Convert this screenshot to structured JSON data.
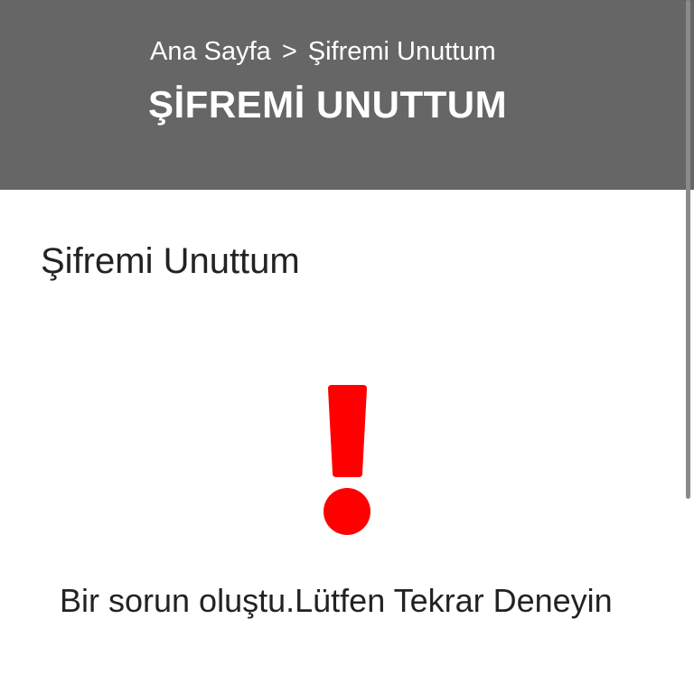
{
  "breadcrumb": {
    "home": "Ana Sayfa",
    "separator": ">",
    "current": "Şifremi Unuttum"
  },
  "header": {
    "title": "ŞİFREMİ UNUTTUM"
  },
  "main": {
    "section_title": "Şifremi Unuttum",
    "alert_icon": "exclamation-icon",
    "alert_color": "#ff0000",
    "error_message": "Bir sorun oluştu.Lütfen Tekrar Deneyin"
  },
  "colors": {
    "header_background": "#666666",
    "page_background": "#ffffff",
    "text": "#222222"
  }
}
